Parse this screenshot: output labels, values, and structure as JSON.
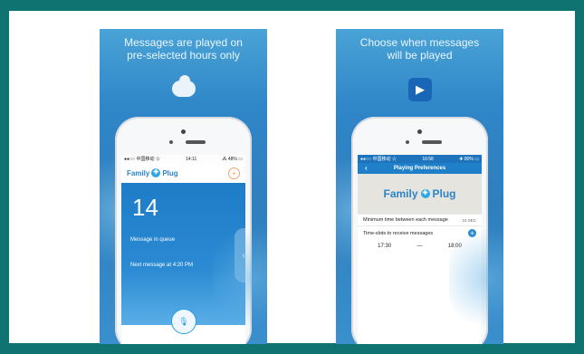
{
  "panel1": {
    "headline_line1": "Messages are played on",
    "headline_line2": "pre-selected hours only",
    "icon": "cloud-clock-icon",
    "status_left": "●●○○ 中国移动 ☆",
    "status_time": "14:11",
    "status_right": "⁂ 48% ▭",
    "logo_text": "Family",
    "logo_sub": "Plug",
    "count": "14",
    "queue_label": "Message in queue",
    "next_label": "Next message at 4:20 PM"
  },
  "panel2": {
    "headline_line1": "Choose when messages",
    "headline_line2": "will be played",
    "icon": "play-icon",
    "status_left": "●●○○ 中国移动 ☆",
    "status_time": "16:58",
    "status_right": "✚ 80% ▭",
    "screen_title": "Playing Preferences",
    "logo_text": "Family",
    "logo_sub": "Plug",
    "min_time_label": "Minimum time between each message",
    "min_time_value": "10 SEC",
    "timeslots_label": "Time-slots to receive messages",
    "time_start": "17:30",
    "time_sep": "—",
    "time_end": "18:00"
  }
}
